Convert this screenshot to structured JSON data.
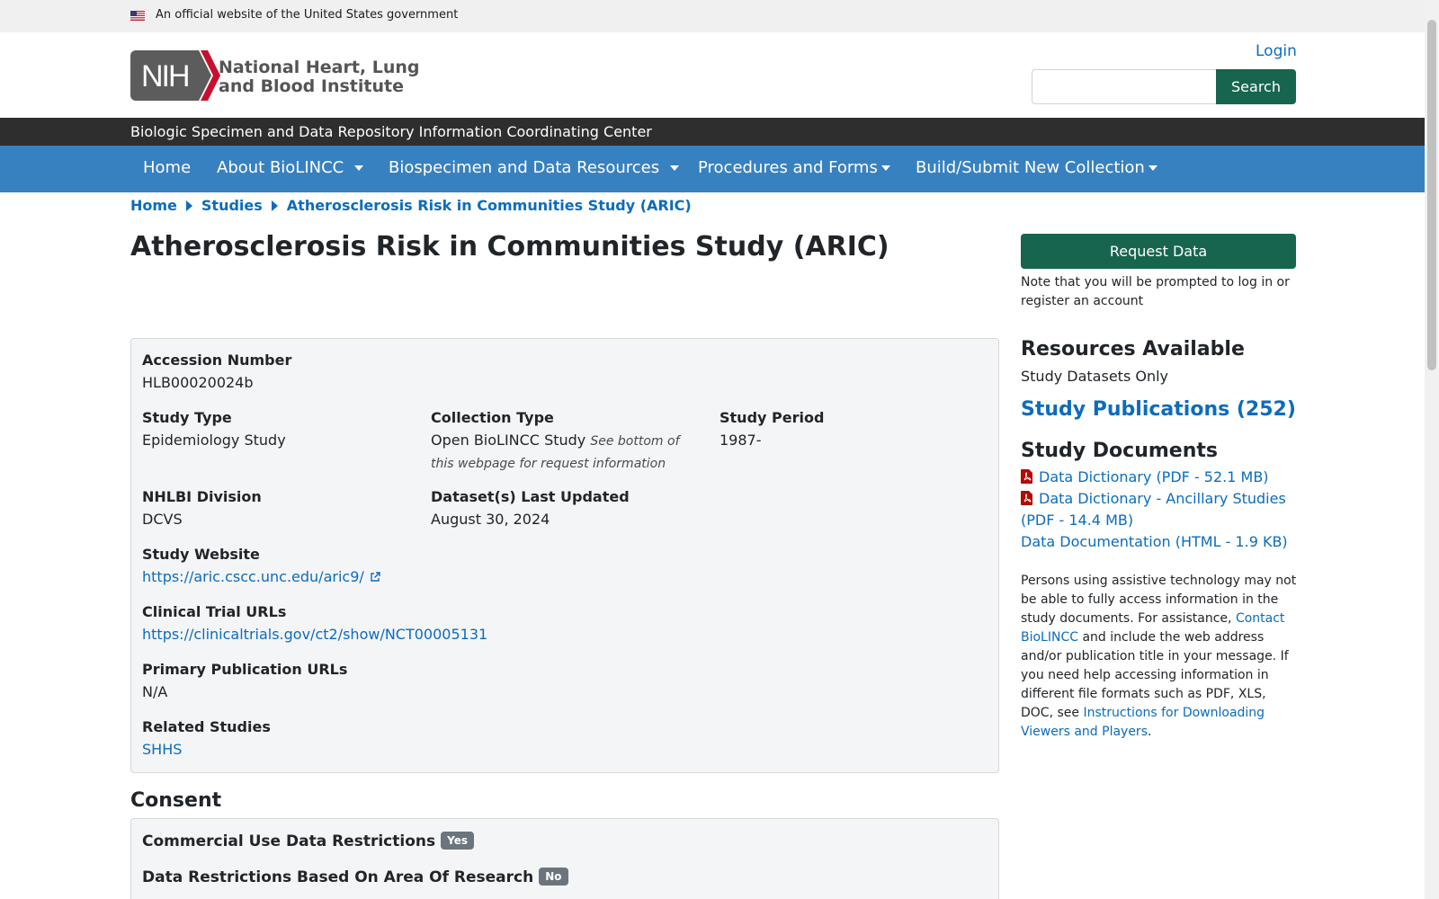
{
  "gov_banner": {
    "text": "An official website of the United States government",
    "flag_icon": "us-flag-icon"
  },
  "header": {
    "logo_mark": "NIH",
    "logo_line1": "National Heart, Lung,",
    "logo_line2": "and Blood Institute",
    "login_label": "Login",
    "search_placeholder": "",
    "search_button": "Search"
  },
  "subtitle": "Biologic Specimen and Data Repository Information Coordinating Center",
  "nav": {
    "items": [
      {
        "label": "Home",
        "dropdown": false
      },
      {
        "label": "About BioLINCC",
        "dropdown": true
      },
      {
        "label": "Biospecimen and Data Resources",
        "dropdown": true
      },
      {
        "label": "Procedures and Forms",
        "dropdown": true
      },
      {
        "label": "Build/Submit New Collection",
        "dropdown": true
      }
    ]
  },
  "breadcrumb": [
    "Home",
    "Studies",
    "Atherosclerosis Risk in Communities Study (ARIC)"
  ],
  "page_title": "Atherosclerosis Risk in Communities Study (ARIC)",
  "study_info": {
    "accession": {
      "label": "Accession Number",
      "value": "HLB00020024b"
    },
    "study_type": {
      "label": "Study Type",
      "value": "Epidemiology Study"
    },
    "collection_type": {
      "label": "Collection Type",
      "value": "Open BioLINCC Study",
      "note": "See bottom of this webpage for request information"
    },
    "study_period": {
      "label": "Study Period",
      "value": "1987-"
    },
    "division": {
      "label": "NHLBI Division",
      "value": "DCVS"
    },
    "last_updated": {
      "label": "Dataset(s) Last Updated",
      "value": "August 30, 2024"
    },
    "website": {
      "label": "Study Website",
      "value": "https://aric.cscc.unc.edu/aric9/"
    },
    "clinical_trial": {
      "label": "Clinical Trial URLs",
      "value": "https://clinicaltrials.gov/ct2/show/NCT00005131"
    },
    "primary_pub": {
      "label": "Primary Publication URLs",
      "value": "N/A"
    },
    "related": {
      "label": "Related Studies",
      "value": "SHHS"
    }
  },
  "consent": {
    "heading": "Consent",
    "rows": [
      {
        "label": "Commercial Use Data Restrictions",
        "badge": "Yes"
      },
      {
        "label": "Data Restrictions Based On Area Of Research",
        "badge": "No"
      }
    ]
  },
  "sidebar": {
    "request_button": "Request Data",
    "request_note": "Note that you will be prompted to log in or register an account",
    "resources_heading": "Resources Available",
    "resources_value": "Study Datasets Only",
    "publications_link": "Study Publications (252)",
    "documents_heading": "Study Documents",
    "documents": [
      {
        "label": "Data Dictionary (PDF - 52.1 MB)",
        "icon": "pdf-icon"
      },
      {
        "label": "Data Dictionary - Ancillary Studies (PDF - 14.4 MB)",
        "icon": "pdf-icon"
      },
      {
        "label": "Data Documentation (HTML - 1.9 KB)",
        "icon": ""
      }
    ],
    "assist_text_1": "Persons using assistive technology may not be able to fully access information in the study documents. For assistance,",
    "assist_link_1": "Contact BioLINCC",
    "assist_text_2": "and include the web address and/or publication title in your message. If you need help accessing information in different file formats such as PDF, XLS, DOC, see",
    "assist_link_2": "Instructions for Downloading Viewers and Players",
    "assist_text_3": "."
  },
  "colors": {
    "primary_green": "#17654f",
    "nav_blue": "#3881c0",
    "link_blue": "#0b6cbd",
    "dark_bar": "#2e2e2e",
    "nih_red": "#c8102e"
  }
}
